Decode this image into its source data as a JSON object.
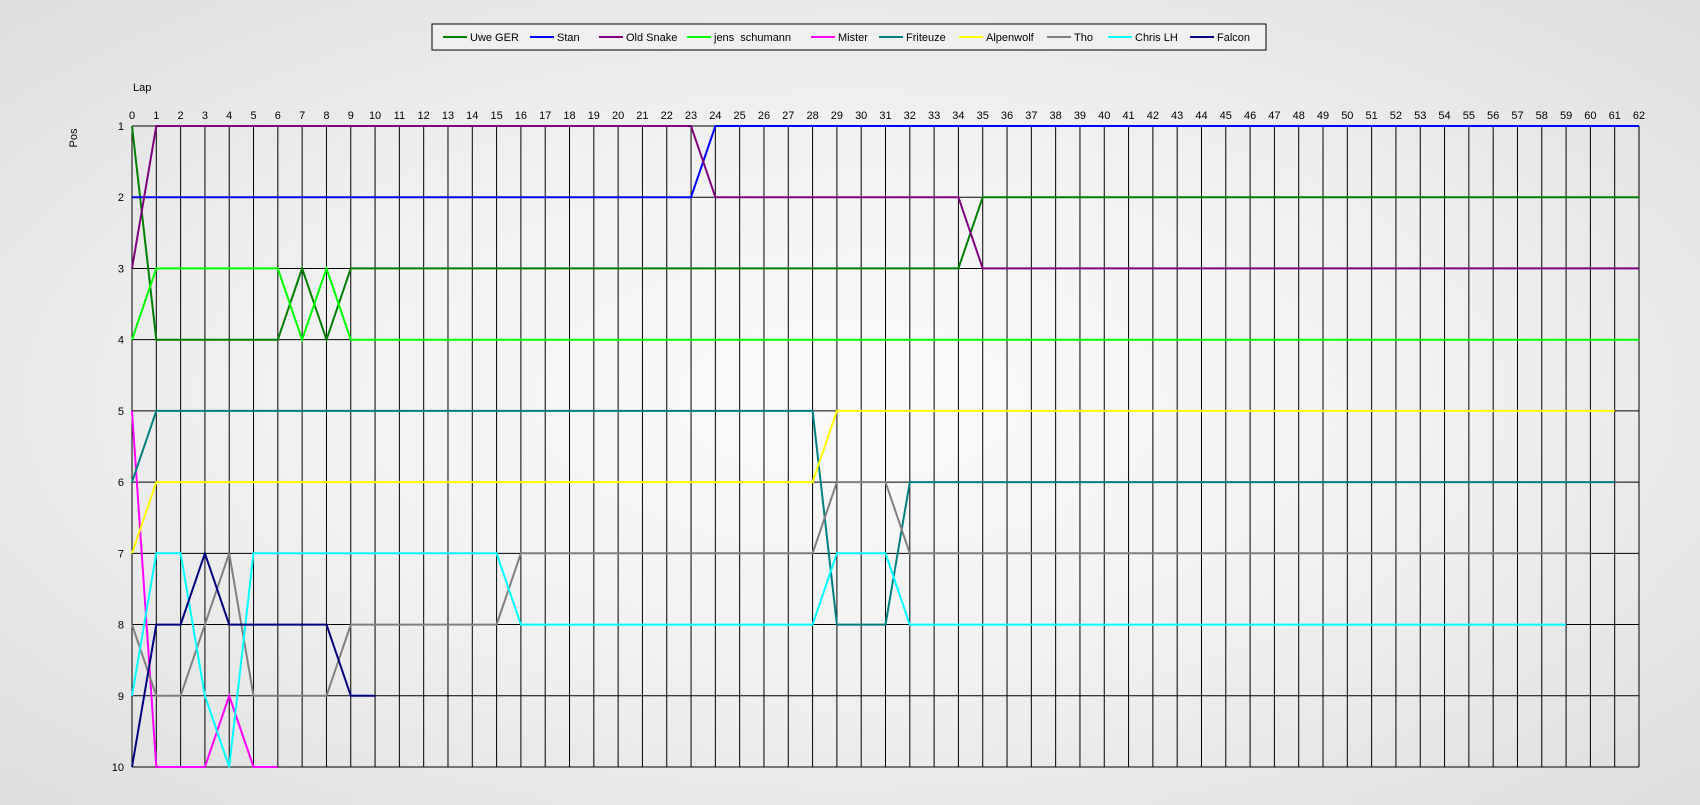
{
  "chart_data": {
    "type": "line",
    "xlabel": "Lap",
    "ylabel": "Pos",
    "xlim": [
      0,
      62
    ],
    "ylim": [
      1,
      10
    ],
    "y_inverted": true,
    "grid": true,
    "legend_position": "top-center",
    "x": [
      0,
      1,
      2,
      3,
      4,
      5,
      6,
      7,
      8,
      9,
      10,
      11,
      12,
      13,
      14,
      15,
      16,
      17,
      18,
      19,
      20,
      21,
      22,
      23,
      24,
      25,
      26,
      27,
      28,
      29,
      30,
      31,
      32,
      33,
      34,
      35,
      36,
      37,
      38,
      39,
      40,
      41,
      42,
      43,
      44,
      45,
      46,
      47,
      48,
      49,
      50,
      51,
      52,
      53,
      54,
      55,
      56,
      57,
      58,
      59,
      60,
      61,
      62
    ],
    "y_ticks": [
      1,
      2,
      3,
      4,
      5,
      6,
      7,
      8,
      9,
      10
    ],
    "series": [
      {
        "name": "Uwe GER",
        "color": "#008000",
        "points": [
          [
            0,
            1
          ],
          [
            1,
            4
          ],
          [
            6,
            4
          ],
          [
            7,
            3
          ],
          [
            8,
            4
          ],
          [
            9,
            3
          ],
          [
            34,
            3
          ],
          [
            35,
            2
          ],
          [
            62,
            2
          ]
        ]
      },
      {
        "name": "Stan",
        "color": "#0000ff",
        "points": [
          [
            0,
            2
          ],
          [
            23,
            2
          ],
          [
            24,
            1
          ],
          [
            62,
            1
          ]
        ]
      },
      {
        "name": "Old Snake",
        "color": "#800080",
        "points": [
          [
            0,
            3
          ],
          [
            1,
            1
          ],
          [
            23,
            1
          ],
          [
            24,
            2
          ],
          [
            34,
            2
          ],
          [
            35,
            3
          ],
          [
            62,
            3
          ]
        ]
      },
      {
        "name": "jens  schumann",
        "color": "#00ff00",
        "points": [
          [
            0,
            4
          ],
          [
            1,
            3
          ],
          [
            6,
            3
          ],
          [
            7,
            4
          ],
          [
            8,
            3
          ],
          [
            9,
            4
          ],
          [
            62,
            4
          ]
        ]
      },
      {
        "name": "Mister",
        "color": "#ff00ff",
        "points": [
          [
            0,
            5
          ],
          [
            1,
            10
          ],
          [
            3,
            10
          ],
          [
            4,
            9
          ],
          [
            5,
            10
          ],
          [
            6,
            10
          ]
        ]
      },
      {
        "name": "Friteuze",
        "color": "#008080",
        "points": [
          [
            0,
            6
          ],
          [
            1,
            5
          ],
          [
            28,
            5
          ],
          [
            29,
            8
          ],
          [
            31,
            8
          ],
          [
            32,
            6
          ],
          [
            61,
            6
          ]
        ]
      },
      {
        "name": "Alpenwolf",
        "color": "#ffff00",
        "points": [
          [
            0,
            7
          ],
          [
            1,
            6
          ],
          [
            28,
            6
          ],
          [
            29,
            5
          ],
          [
            61,
            5
          ]
        ]
      },
      {
        "name": "Tho",
        "color": "#808080",
        "points": [
          [
            0,
            8
          ],
          [
            1,
            9
          ],
          [
            2,
            9
          ],
          [
            3,
            8
          ],
          [
            4,
            7
          ],
          [
            5,
            9
          ],
          [
            8,
            9
          ],
          [
            9,
            8
          ],
          [
            15,
            8
          ],
          [
            16,
            7
          ],
          [
            28,
            7
          ],
          [
            29,
            6
          ],
          [
            31,
            6
          ],
          [
            32,
            7
          ],
          [
            60,
            7
          ]
        ]
      },
      {
        "name": "Chris LH",
        "color": "#00ffff",
        "points": [
          [
            0,
            9
          ],
          [
            1,
            7
          ],
          [
            2,
            7
          ],
          [
            3,
            9
          ],
          [
            4,
            10
          ],
          [
            5,
            7
          ],
          [
            15,
            7
          ],
          [
            16,
            8
          ],
          [
            28,
            8
          ],
          [
            29,
            7
          ],
          [
            31,
            7
          ],
          [
            32,
            8
          ],
          [
            59,
            8
          ]
        ]
      },
      {
        "name": "Falcon",
        "color": "#000080",
        "points": [
          [
            0,
            10
          ],
          [
            1,
            8
          ],
          [
            2,
            8
          ],
          [
            3,
            7
          ],
          [
            4,
            8
          ],
          [
            8,
            8
          ],
          [
            9,
            9
          ],
          [
            10,
            9
          ]
        ]
      }
    ]
  }
}
